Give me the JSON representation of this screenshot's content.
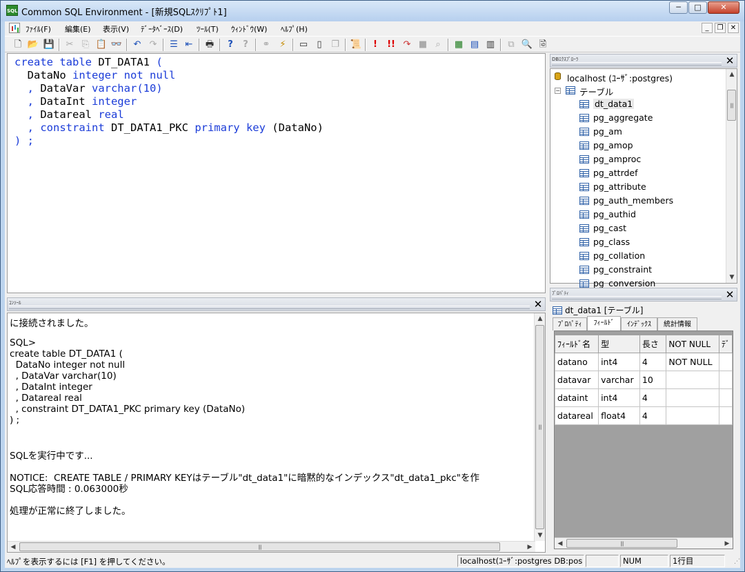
{
  "window": {
    "title": "Common SQL Environment - [新規SQLｽｸﾘﾌﾟﾄ1]",
    "app_icon_text": "SQL",
    "controls": {
      "minimize": "─",
      "maximize": "□",
      "close": "✕"
    }
  },
  "menubar": {
    "items": [
      {
        "label": "ﾌｧｲﾙ(F)"
      },
      {
        "label": "編集(E)"
      },
      {
        "label": "表示(V)"
      },
      {
        "label": "ﾃﾞｰﾀﾍﾞｰｽ(D)"
      },
      {
        "label": "ﾂｰﾙ(T)"
      },
      {
        "label": "ｳｨﾝﾄﾞｳ(W)"
      },
      {
        "label": "ﾍﾙﾌﾟ(H)"
      }
    ],
    "mdi": {
      "minimize": "_",
      "restore": "❐",
      "close": "✕"
    }
  },
  "toolbar": {
    "icons": [
      "new-file-icon",
      "open-folder-icon",
      "save-icon",
      "cut-icon",
      "copy-icon",
      "paste-icon",
      "find-icon",
      "undo-icon",
      "redo-icon",
      "indent-icon",
      "unindent-icon",
      "print-icon",
      "help-icon",
      "context-help-icon",
      "connect-icon",
      "disconnect-icon",
      "window-icon",
      "blank-page-icon",
      "cascade-icon",
      "script-icon",
      "execute-icon",
      "execute-all-icon",
      "step-icon",
      "stop-icon",
      "explain-icon",
      "table-export-icon",
      "table-import-icon",
      "table-edit-icon",
      "compare-icon",
      "search-icon",
      "properties-icon"
    ],
    "glyphs": {
      "new": "🗋",
      "open": "📂",
      "save": "💾",
      "cut": "✂",
      "copy": "⎘",
      "paste": "📋",
      "find": "👓",
      "undo": "↶",
      "redo": "↷",
      "indent": "☰",
      "unindent": "⇤",
      "print": "🖶",
      "help": "?",
      "context_help": "?",
      "connect": "⚭",
      "disconnect": "⚡",
      "window": "▭",
      "page": "▯",
      "cascade": "❐",
      "script": "📜",
      "exec": "!",
      "exec_all": "!!",
      "step": "↷",
      "stop": "■",
      "explain": "⌕",
      "export": "▦",
      "import": "▤",
      "edit": "▥",
      "compare": "⧉",
      "search": "🔍",
      "props": "🗟"
    }
  },
  "editor": {
    "lines": [
      {
        "kw1": "create table",
        "text1": " DT_DATA1 ",
        "kw2": "("
      },
      {
        "text0": "  DataNo ",
        "kw1": "integer not null"
      },
      {
        "kw0": "  , ",
        "text1": "DataVar ",
        "kw2": "varchar",
        "text2": "(10)"
      },
      {
        "kw0": "  , ",
        "text1": "DataInt ",
        "kw2": "integer"
      },
      {
        "kw0": "  , ",
        "text1": "Datareal ",
        "kw2": "real"
      },
      {
        "kw0": "  , ",
        "kw1": "constraint",
        "text1": " DT_DATA1_PKC ",
        "kw2": "primary key",
        "text2": " (DataNo)"
      },
      {
        "kw0": ") ;"
      }
    ]
  },
  "console": {
    "title": "ｺﾝｿｰﾙ",
    "lines": [
      "に接続されました。",
      "",
      "SQL>",
      "create table DT_DATA1 (",
      "  DataNo integer not null",
      "  , DataVar varchar(10)",
      "  , DataInt integer",
      "  , Datareal real",
      "  , constraint DT_DATA1_PKC primary key (DataNo)",
      ") ;",
      "",
      "",
      "SQLを実行中です...",
      "",
      "NOTICE:  CREATE TABLE / PRIMARY KEYはテーブル\"dt_data1\"に暗黙的なインデックス\"dt_data1_pkc\"を作",
      "SQL応答時間 : 0.063000秒",
      "",
      "処理が正常に終了しました。"
    ]
  },
  "db_explorer": {
    "title": "DBｴｸｽﾌﾟﾛｰﾗ",
    "connection": "localhost (ﾕｰｻﾞ:postgres)",
    "folder": "テーブル",
    "tables": [
      "dt_data1",
      "pg_aggregate",
      "pg_am",
      "pg_amop",
      "pg_amproc",
      "pg_attrdef",
      "pg_attribute",
      "pg_auth_members",
      "pg_authid",
      "pg_cast",
      "pg_class",
      "pg_collation",
      "pg_constraint",
      "pg_conversion"
    ],
    "selected": "dt_data1"
  },
  "properties": {
    "title": "ﾌﾟﾛﾊﾟﾃｨ",
    "header": "dt_data1 [テーブル]",
    "tabs": [
      "ﾌﾟﾛﾊﾟﾃｨ",
      "ﾌｨｰﾙﾄﾞ",
      "ｲﾝﾃﾞｯｸｽ",
      "統計情報"
    ],
    "active_tab": "ﾌｨｰﾙﾄﾞ",
    "columns": [
      "ﾌｨｰﾙﾄﾞ名",
      "型",
      "長さ",
      "NOT NULL",
      "ﾃﾞ"
    ],
    "rows": [
      [
        "datano",
        "int4",
        "4",
        "NOT NULL",
        ""
      ],
      [
        "datavar",
        "varchar",
        "10",
        "",
        ""
      ],
      [
        "dataint",
        "int4",
        "4",
        "",
        ""
      ],
      [
        "datareal",
        "float4",
        "4",
        "",
        ""
      ]
    ]
  },
  "statusbar": {
    "help_text": "ﾍﾙﾌﾟを表示するには [F1] を押してください。",
    "connection": "localhost(ﾕｰｻﾞ:postgres DB:pos",
    "num": "NUM",
    "line": "1行目"
  }
}
